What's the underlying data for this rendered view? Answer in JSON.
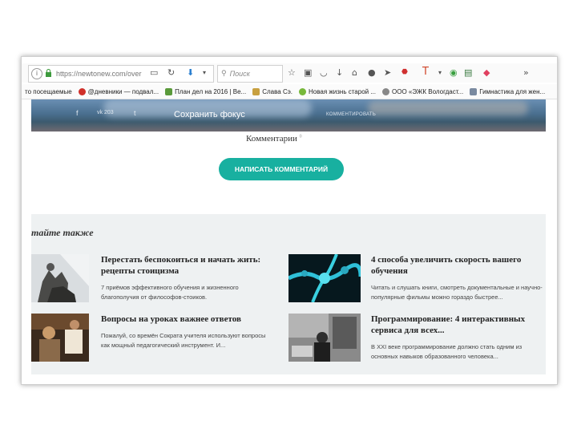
{
  "browser": {
    "url": "https://newtonew.com/over",
    "search_placeholder": "Поиск",
    "bookmarks": [
      {
        "label": "то посещаемые",
        "color": ""
      },
      {
        "label": "@дневники — подвал...",
        "color": "#d0302a"
      },
      {
        "label": "План дел на 2016 | Ве...",
        "color": "#5a9a3a"
      },
      {
        "label": "Слава Сэ.",
        "color": "#c8a040"
      },
      {
        "label": "Новая жизнь старой ...",
        "color": "#77b83a"
      },
      {
        "label": "ООО «ЭЖК Вологдаст...",
        "color": "#888888"
      },
      {
        "label": "Гимнастика для жен...",
        "color": "#7a8aa0"
      }
    ]
  },
  "hero": {
    "social": [
      "f",
      "vk 203",
      "t"
    ],
    "title": "Сохранить фокус",
    "comment_link": "КОММЕНТИРОВАТЬ"
  },
  "comments": {
    "heading": "Комментарии",
    "count": "0",
    "button": "НАПИСАТЬ КОММЕНТАРИЙ"
  },
  "related": {
    "heading": "тайте также",
    "cards": [
      {
        "title": "Перестать беспокоиться и начать жить: рецепты стоицизма",
        "desc": "7 приёмов эффективного обучения и жизненного благополучия от философов-стоиков."
      },
      {
        "title": "4 способа увеличить скорость вашего обучения",
        "desc": "Читать и слушать книги, смотреть документальные и научно-популярные фильмы можно гораздо быстрее..."
      },
      {
        "title": "Вопросы на уроках важнее ответов",
        "desc": "Пожалуй, со времён Сократа учителя используют вопросы как мощный педагогический инструмент. И..."
      },
      {
        "title": "Программирование: 4 интерактивных сервиса для всех...",
        "desc": "В XXI веке программирование должно стать одним из основных навыков образованного человека..."
      }
    ]
  },
  "colors": {
    "accent": "#18b0a0",
    "related_bg": "#eef1f2"
  }
}
